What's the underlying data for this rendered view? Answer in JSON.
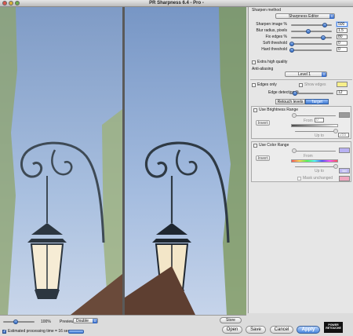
{
  "window": {
    "title": "PR Sharpness 6.4 - Pro -"
  },
  "preview": {
    "zoom_label": "100%",
    "preview_label": "Preview",
    "preview_mode": "Double",
    "store_label": "Store",
    "estimate_label": "Estimated processing time = 16 sec.",
    "estimate_checked": true,
    "zoom_level": 0.35
  },
  "panel": {
    "method_label": "Sharpen method",
    "method_value": "Sharpness Editor",
    "params": [
      {
        "label": "Sharpen image %",
        "value": "500",
        "level": 0.83,
        "selected": true
      },
      {
        "label": "Blur radius, pixels",
        "value": "1.5",
        "level": 0.42,
        "selected": false
      },
      {
        "label": "Fix edges %",
        "value": "80",
        "level": 0.8,
        "selected": false
      },
      {
        "label": "Soft threshold",
        "value": "0",
        "level": 0.0,
        "selected": false
      },
      {
        "label": "Hard threshold",
        "value": "0",
        "level": 0.0,
        "selected": false
      }
    ],
    "extra_quality_label": "Extra high quality",
    "antialiasing_label": "Anti-aliasing",
    "antialiasing_value": "Level 1",
    "edges_only_label": "Edges only",
    "show_edges_label": "Show edges",
    "edge_detection_label": "Edge detection %",
    "edge_detection_value": "12",
    "edge_detection_level": 0.12,
    "tabs": [
      "Retouch levels",
      "Target range"
    ],
    "active_tab": 1,
    "brightness_label": "Use Brightness Range",
    "brightness_from_label": "From",
    "brightness_from_value": "0",
    "brightness_upto_label": "Up to",
    "brightness_upto_value": "255",
    "invert_label": "Invert",
    "color_label": "Use Color Range",
    "color_from_label": "From",
    "color_upto_label": "Up to",
    "color_upto_value": "360",
    "mask_label": "Mask unchanged",
    "colors": {
      "edge_swatch": "#f7ef8a",
      "brightness_swatch": "#9a9a9a",
      "color_swatch_from": "#b8b1f2",
      "color_swatch_to": "#bcb8f0",
      "mask_swatch": "#f0a6bf",
      "accent": "#3f7bd7"
    }
  },
  "buttons": {
    "open": "Open",
    "save": "Save",
    "cancel": "Cancel",
    "apply": "Apply"
  },
  "logo_text": [
    "POWER",
    "RETOUCHE"
  ]
}
